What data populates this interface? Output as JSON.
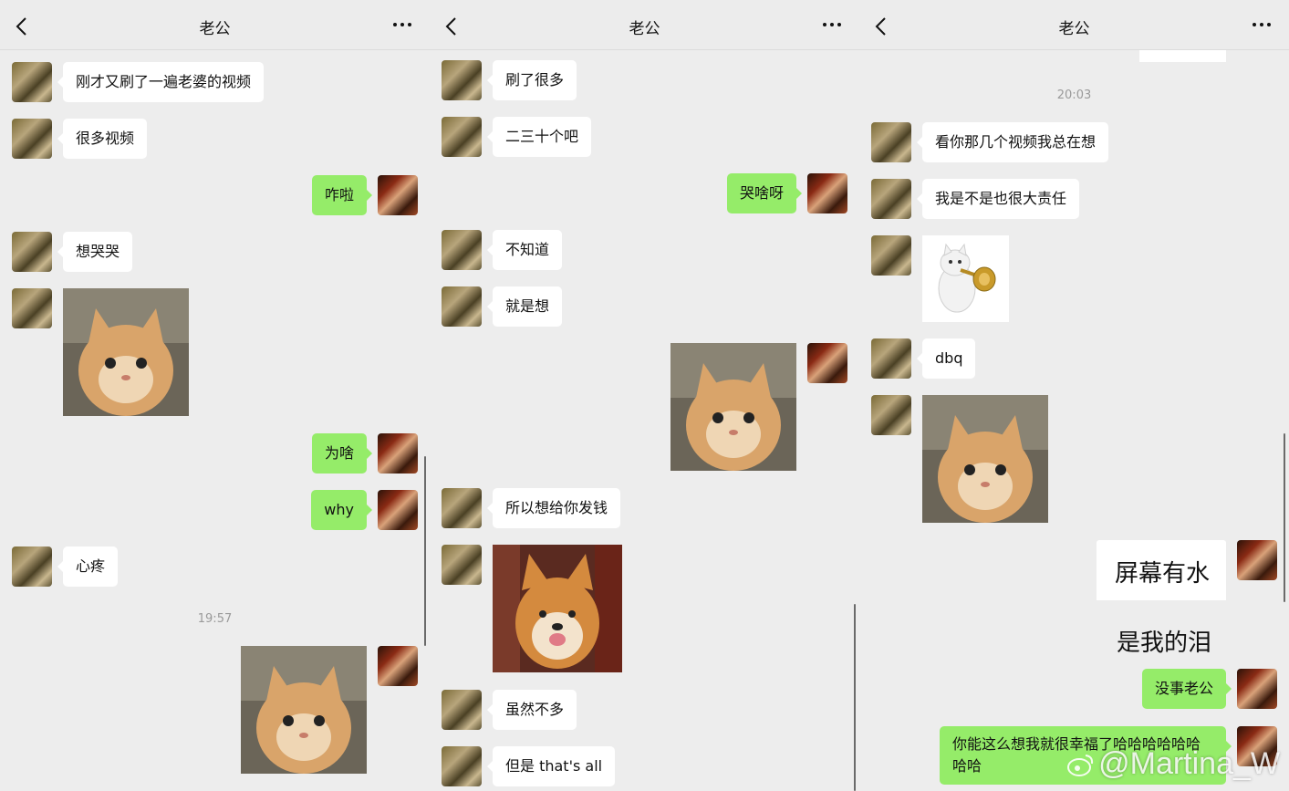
{
  "header": {
    "title": "老公"
  },
  "panel1": {
    "messages": [
      "刚才又刷了一遍老婆的视频",
      "很多视频",
      "咋啦",
      "想哭哭",
      "为啥",
      "why",
      "心疼"
    ],
    "time": "19:57"
  },
  "panel2": {
    "messages": [
      "刷了很多",
      "二三十个吧",
      "哭啥呀",
      "不知道",
      "就是想",
      "所以想给你发钱",
      "虽然不多",
      "但是 that's all"
    ]
  },
  "panel3": {
    "time": "20:03",
    "messages": [
      "看你那几个视频我总在想",
      "我是不是也很大责任",
      "dbq",
      "没事老公",
      "你能这么想我就很幸福了哈哈哈哈哈哈哈哈"
    ],
    "reply_sticker": {
      "line1": "屏幕有水",
      "line2": "是我的泪"
    }
  },
  "watermark": "@Martina_W",
  "colors": {
    "background": "#ededed",
    "green_bubble": "#95ec69",
    "white_bubble": "#ffffff"
  }
}
